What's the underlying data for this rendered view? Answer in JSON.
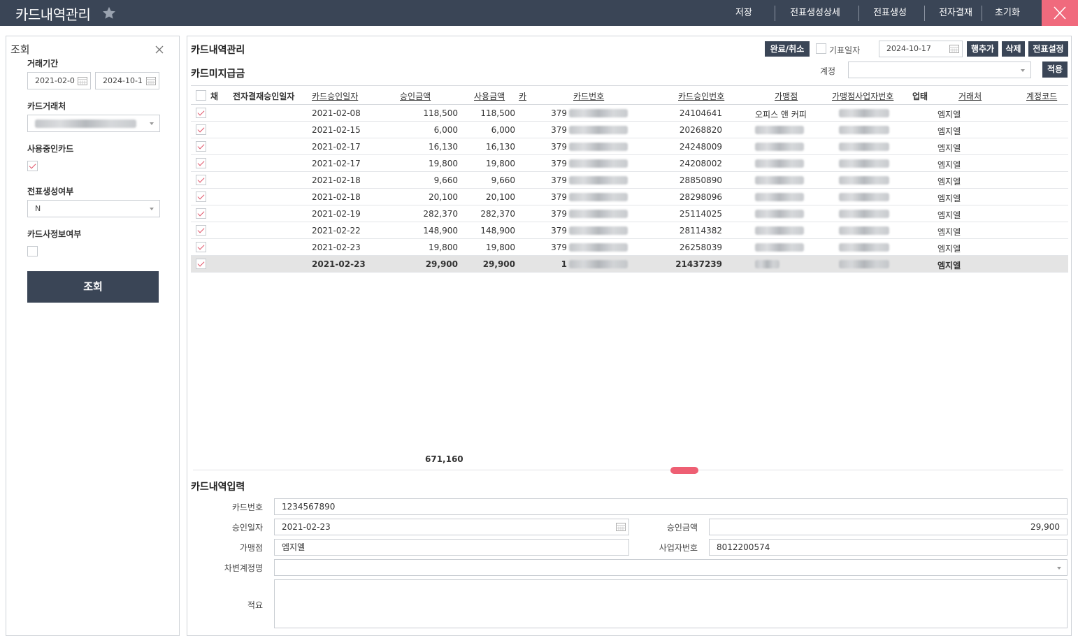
{
  "app": {
    "title": "카드내역관리"
  },
  "topmenu": {
    "save": "저장",
    "voucher_detail": "전표생성상세",
    "voucher_create": "전표생성",
    "e_approval": "전자결재",
    "reset": "초기화"
  },
  "search_panel": {
    "title": "조회",
    "period_label": "거래기간",
    "date_from": "2021-02-0",
    "date_to": "2024-10-1",
    "vendor_label": "카드거래처",
    "in_use_label": "사용중인카드",
    "in_use_checked": true,
    "voucher_label": "전표생성여부",
    "voucher_value": "N",
    "private_label": "카드사정보여부",
    "private_checked": false,
    "search_button": "조회"
  },
  "main": {
    "title": "카드내역관리",
    "btn_complete": "완료/취소",
    "voucher_date_label": "기표일자",
    "voucher_date": "2024-10-17",
    "btn_add_row": "행추가",
    "btn_delete": "삭제",
    "btn_settings": "전표설정",
    "unpaid_title": "카드미지급금",
    "account_label": "계정",
    "btn_apply": "적용",
    "columns": {
      "c0": "채",
      "c1": "전자결재승인일자",
      "c2": "카드승인일자",
      "c3": "승인금액",
      "c4": "사용금액",
      "c5": "카",
      "c6": "카드번호",
      "c7": "카드승인번호",
      "c8": "가맹점",
      "c9": "가맹점사업자번호",
      "c10": "업태",
      "c11": "거래처",
      "c12": "계정코드"
    },
    "rows": [
      {
        "date": "2021-02-08",
        "approved": "118,500",
        "used": "118,500",
        "card": "379",
        "appr_no": "24104641",
        "store": "오피스 앤 커피",
        "vendor": "엠지엘"
      },
      {
        "date": "2021-02-15",
        "approved": "6,000",
        "used": "6,000",
        "card": "379",
        "appr_no": "20268820",
        "store": "",
        "vendor": "엠지엘"
      },
      {
        "date": "2021-02-17",
        "approved": "16,130",
        "used": "16,130",
        "card": "379",
        "appr_no": "24248009",
        "store": "",
        "vendor": "엠지엘"
      },
      {
        "date": "2021-02-17",
        "approved": "19,800",
        "used": "19,800",
        "card": "379",
        "appr_no": "24208002",
        "store": "",
        "vendor": "엠지엘"
      },
      {
        "date": "2021-02-18",
        "approved": "9,660",
        "used": "9,660",
        "card": "379",
        "appr_no": "28850890",
        "store": "",
        "vendor": "엠지엘"
      },
      {
        "date": "2021-02-18",
        "approved": "20,100",
        "used": "20,100",
        "card": "379",
        "appr_no": "28298096",
        "store": "",
        "vendor": "엠지엘"
      },
      {
        "date": "2021-02-19",
        "approved": "282,370",
        "used": "282,370",
        "card": "379",
        "appr_no": "25114025",
        "store": "",
        "vendor": "엠지엘"
      },
      {
        "date": "2021-02-22",
        "approved": "148,900",
        "used": "148,900",
        "card": "379",
        "appr_no": "28114382",
        "store": "",
        "vendor": "엠지엘"
      },
      {
        "date": "2021-02-23",
        "approved": "19,800",
        "used": "19,800",
        "card": "379",
        "appr_no": "26258039",
        "store": "",
        "vendor": "엠지엘"
      },
      {
        "date": "2021-02-23",
        "approved": "29,900",
        "used": "29,900",
        "card": "1",
        "appr_no": "21437239",
        "store": "",
        "vendor": "엠지엘"
      }
    ],
    "total": "671,160"
  },
  "form": {
    "title": "카드내역입력",
    "card_no_label": "카드번호",
    "card_no": "1234567890",
    "appr_date_label": "승인일자",
    "appr_date": "2021-02-23",
    "appr_amt_label": "승인금액",
    "appr_amt": "29,900",
    "store_label": "가맹점",
    "store": "엠지엘",
    "biz_no_label": "사업자번호",
    "biz_no": "8012200574",
    "debit_label": "차변계정명",
    "memo_label": "적요"
  },
  "colors": {
    "header_bg": "#3a4556",
    "close_bg": "#f06a7d",
    "accent": "#ee5f73"
  }
}
